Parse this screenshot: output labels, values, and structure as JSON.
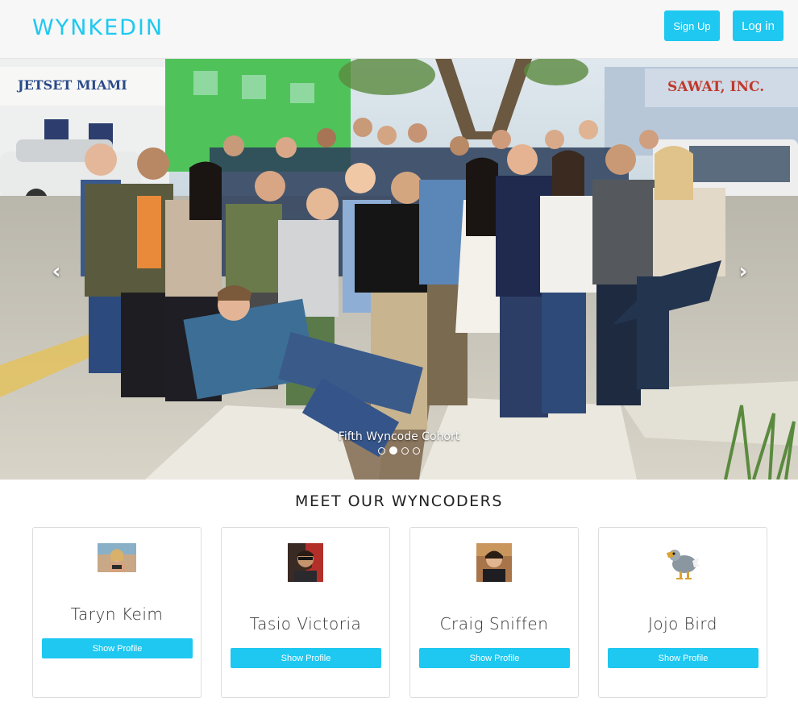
{
  "brand": "WYNKEDIN",
  "nav": {
    "signup_label": "Sign Up",
    "login_label": "Log in"
  },
  "carousel": {
    "caption": "Fifth Wyncode Cohort",
    "prev_glyph": "‹",
    "next_glyph": "›",
    "slide_count": 4,
    "active_index": 1,
    "signage": {
      "jetset": "JETSET MIAMI",
      "sawat": "SAWAT, INC."
    }
  },
  "section": {
    "title": "MEET OUR WYNCODERS"
  },
  "wyncoders": [
    {
      "name": "Taryn Keim",
      "button": "Show Profile"
    },
    {
      "name": "Tasio Victoria",
      "button": "Show Profile"
    },
    {
      "name": "Craig Sniffen",
      "button": "Show Profile"
    },
    {
      "name": "Jojo Bird",
      "button": "Show Profile"
    }
  ],
  "colors": {
    "accent": "#1ec8f0",
    "navbar_bg": "#f7f7f7"
  }
}
